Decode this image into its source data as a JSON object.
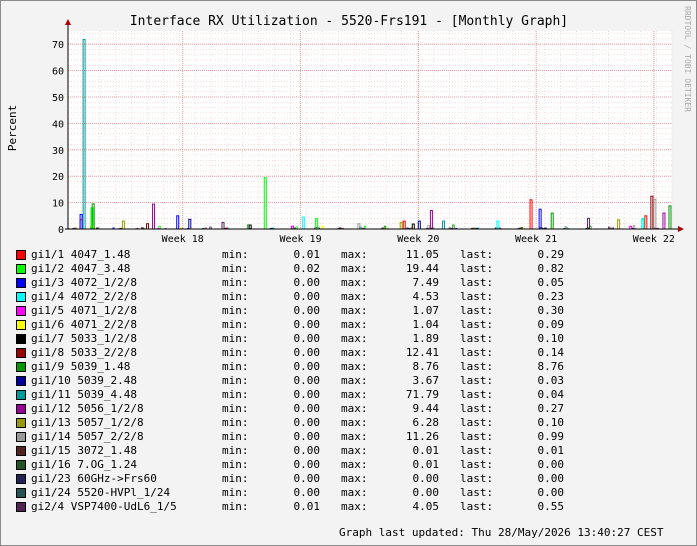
{
  "chart_data": {
    "type": "bar",
    "title": "Interface RX Utilization - 5520-Frs191 - [Monthly Graph]",
    "ylabel": "Percent",
    "watermark": "RRDTOOL / TOBI OETIKER",
    "ylim": [
      0,
      75
    ],
    "yticks": [
      0,
      10,
      20,
      30,
      40,
      50,
      60,
      70
    ],
    "xticks": [
      "Week 18",
      "Week 19",
      "Week 20",
      "Week 21",
      "Week 22"
    ],
    "grid": true,
    "legend_position": "bottom",
    "summary_labels": {
      "min": "min:",
      "max": "max:",
      "last": "last:"
    },
    "series": [
      {
        "name": "gi1/1 4047_1.48",
        "color": "#ff0000",
        "min": "0.01",
        "max": "11.05",
        "last": "0.29"
      },
      {
        "name": "gi1/2 4047_3.48",
        "color": "#00ff00",
        "min": "0.02",
        "max": "19.44",
        "last": "0.82"
      },
      {
        "name": "gi1/3 4072_1/2/8",
        "color": "#0000ff",
        "min": "0.00",
        "max": "7.49",
        "last": "0.05"
      },
      {
        "name": "gi1/4 4072_2/2/8",
        "color": "#00ffff",
        "min": "0.00",
        "max": "4.53",
        "last": "0.23"
      },
      {
        "name": "gi1/5 4071_1/2/8",
        "color": "#ff00ff",
        "min": "0.00",
        "max": "1.07",
        "last": "0.30"
      },
      {
        "name": "gi1/6 4071_2/2/8",
        "color": "#ffff00",
        "min": "0.00",
        "max": "1.04",
        "last": "0.09"
      },
      {
        "name": "gi1/7 5033_1/2/8",
        "color": "#000000",
        "min": "0.00",
        "max": "1.89",
        "last": "0.10"
      },
      {
        "name": "gi1/8 5033_2/2/8",
        "color": "#990000",
        "min": "0.00",
        "max": "12.41",
        "last": "0.14"
      },
      {
        "name": "gi1/9 5039_1.48",
        "color": "#009900",
        "min": "0.00",
        "max": "8.76",
        "last": "8.76"
      },
      {
        "name": "gi1/10 5039_2.48",
        "color": "#000099",
        "min": "0.00",
        "max": "3.67",
        "last": "0.03"
      },
      {
        "name": "gi1/11 5039_4.48",
        "color": "#009999",
        "min": "0.00",
        "max": "71.79",
        "last": "0.04"
      },
      {
        "name": "gi1/12 5056_1/2/8",
        "color": "#990099",
        "min": "0.00",
        "max": "9.44",
        "last": "0.27"
      },
      {
        "name": "gi1/13 5057_1/2/8",
        "color": "#999900",
        "min": "0.00",
        "max": "6.28",
        "last": "0.10"
      },
      {
        "name": "gi1/14 5057_2/2/8",
        "color": "#999999",
        "min": "0.00",
        "max": "11.26",
        "last": "0.99"
      },
      {
        "name": "gi1/15 3072_1.48",
        "color": "#552222",
        "min": "0.00",
        "max": "0.01",
        "last": "0.01"
      },
      {
        "name": "gi1/16 7.OG_1.24",
        "color": "#225522",
        "min": "0.00",
        "max": "0.01",
        "last": "0.00"
      },
      {
        "name": "gi1/23 60GHz->Frs60",
        "color": "#222255",
        "min": "0.00",
        "max": "0.00",
        "last": "0.00"
      },
      {
        "name": "gi1/24 5520-HVPl_1/24",
        "color": "#225555",
        "min": "0.00",
        "max": "0.00",
        "last": "0.00"
      },
      {
        "name": "gi2/4 VSP7400-UdL6_1/5",
        "color": "#552255",
        "min": "0.01",
        "max": "4.05",
        "last": "0.55"
      }
    ],
    "spikes": [
      {
        "s": 0,
        "t": 0.02,
        "v": 3.5
      },
      {
        "s": 0,
        "t": 0.555,
        "v": 3.0
      },
      {
        "s": 0,
        "t": 0.765,
        "v": 11.05
      },
      {
        "s": 0,
        "t": 0.955,
        "v": 5.0
      },
      {
        "s": 1,
        "t": 0.038,
        "v": 8.0
      },
      {
        "s": 1,
        "t": 0.325,
        "v": 19.44
      },
      {
        "s": 1,
        "t": 0.41,
        "v": 4.0
      },
      {
        "s": 1,
        "t": 0.95,
        "v": 3.5
      },
      {
        "s": 2,
        "t": 0.02,
        "v": 5.5
      },
      {
        "s": 2,
        "t": 0.18,
        "v": 5.0
      },
      {
        "s": 2,
        "t": 0.78,
        "v": 7.49
      },
      {
        "s": 3,
        "t": 0.388,
        "v": 4.53
      },
      {
        "s": 3,
        "t": 0.71,
        "v": 3.0
      },
      {
        "s": 3,
        "t": 0.95,
        "v": 4.0
      },
      {
        "s": 4,
        "t": 0.37,
        "v": 1.07
      },
      {
        "s": 4,
        "t": 0.93,
        "v": 1.0
      },
      {
        "s": 5,
        "t": 0.04,
        "v": 1.04
      },
      {
        "s": 5,
        "t": 0.42,
        "v": 1.0
      },
      {
        "s": 6,
        "t": 0.57,
        "v": 1.89
      },
      {
        "s": 6,
        "t": 0.3,
        "v": 1.5
      },
      {
        "s": 7,
        "t": 0.965,
        "v": 12.41
      },
      {
        "s": 7,
        "t": 0.13,
        "v": 2.0
      },
      {
        "s": 8,
        "t": 0.04,
        "v": 9.5
      },
      {
        "s": 8,
        "t": 0.8,
        "v": 6.0
      },
      {
        "s": 8,
        "t": 0.995,
        "v": 8.76
      },
      {
        "s": 9,
        "t": 0.2,
        "v": 3.67
      },
      {
        "s": 9,
        "t": 0.58,
        "v": 3.0
      },
      {
        "s": 10,
        "t": 0.025,
        "v": 71.79
      },
      {
        "s": 10,
        "t": 0.62,
        "v": 3.0
      },
      {
        "s": 11,
        "t": 0.14,
        "v": 9.44
      },
      {
        "s": 11,
        "t": 0.6,
        "v": 7.0
      },
      {
        "s": 11,
        "t": 0.985,
        "v": 6.0
      },
      {
        "s": 12,
        "t": 0.09,
        "v": 3.0
      },
      {
        "s": 12,
        "t": 0.55,
        "v": 2.5
      },
      {
        "s": 12,
        "t": 0.91,
        "v": 3.5
      },
      {
        "s": 13,
        "t": 0.97,
        "v": 11.26
      },
      {
        "s": 13,
        "t": 0.48,
        "v": 2.0
      },
      {
        "s": 18,
        "t": 0.86,
        "v": 4.05
      },
      {
        "s": 18,
        "t": 0.255,
        "v": 2.5
      }
    ]
  },
  "footer": {
    "label": "Graph last updated:",
    "value": "Thu 28/May/2026 13:40:27 CEST"
  }
}
